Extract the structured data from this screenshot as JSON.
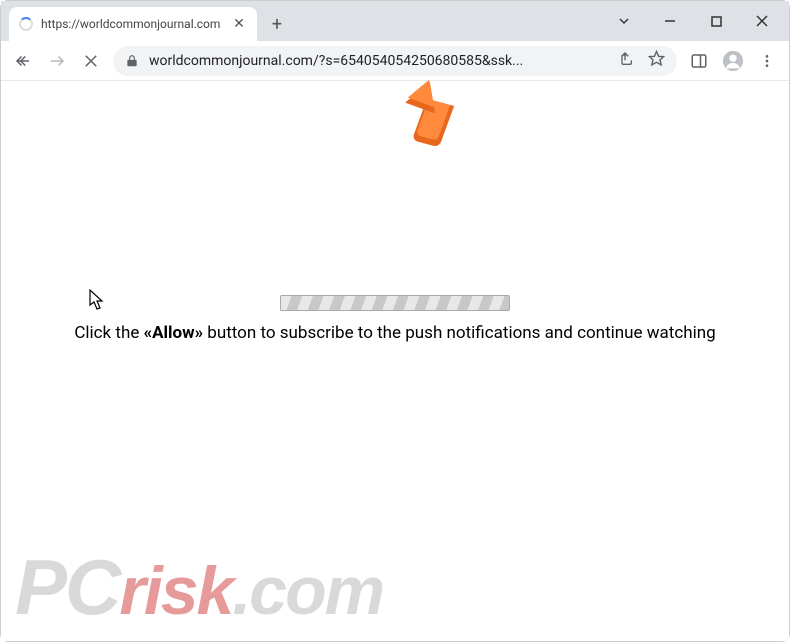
{
  "tab": {
    "title": "https://worldcommonjournal.com"
  },
  "toolbar": {
    "url": "worldcommonjournal.com/?s=654054054250680585&ssk..."
  },
  "page": {
    "msg_pre": "Click the ",
    "msg_bold": "«Allow»",
    "msg_post": " button to subscribe to the push notifications and continue watching"
  },
  "watermark": {
    "pc": "PC",
    "risk": "risk",
    "dotcom": ".com"
  }
}
